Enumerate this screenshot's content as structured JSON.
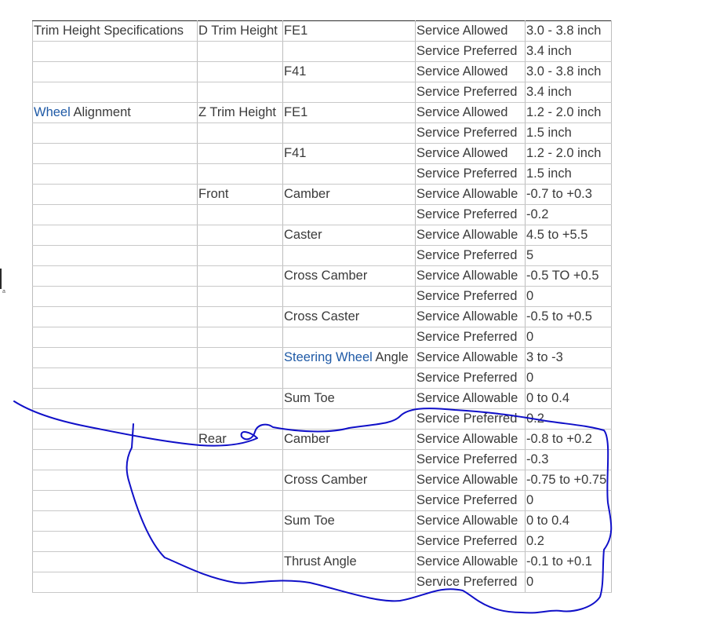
{
  "table": {
    "rows": [
      {
        "c1": "Trim Height Specifications",
        "c1_link": "",
        "c2": "D Trim Height",
        "c3": "FE1",
        "c3_link": "",
        "c4": "Service Allowed",
        "c5": "3.0 - 3.8 inch",
        "bold_top": true
      },
      {
        "c1": "",
        "c1_link": "",
        "c2": "",
        "c3": "",
        "c3_link": "",
        "c4": "Service Preferred",
        "c5": "3.4 inch",
        "bold_top": true
      },
      {
        "c1": "",
        "c1_link": "",
        "c2": "",
        "c3": "F41",
        "c3_link": "",
        "c4": "Service Allowed",
        "c5": "3.0 - 3.8 inch",
        "bold_top": false
      },
      {
        "c1": "",
        "c1_link": "",
        "c2": "",
        "c3": "",
        "c3_link": "",
        "c4": "Service Preferred",
        "c5": "3.4 inch",
        "bold_top": true
      },
      {
        "c1": " Alignment",
        "c1_link": "Wheel",
        "c2": "Z Trim Height",
        "c3": "FE1",
        "c3_link": "",
        "c4": "Service Allowed",
        "c5": "1.2 - 2.0 inch",
        "bold_top": true
      },
      {
        "c1": "",
        "c1_link": "",
        "c2": "",
        "c3": "",
        "c3_link": "",
        "c4": "Service Preferred",
        "c5": "1.5 inch",
        "bold_top": true
      },
      {
        "c1": "",
        "c1_link": "",
        "c2": "",
        "c3": "F41",
        "c3_link": "",
        "c4": "Service Allowed",
        "c5": "1.2 - 2.0 inch",
        "bold_top": false
      },
      {
        "c1": "",
        "c1_link": "",
        "c2": "",
        "c3": "",
        "c3_link": "",
        "c4": "Service Preferred",
        "c5": "1.5 inch",
        "bold_top": true
      },
      {
        "c1": "",
        "c1_link": "",
        "c2": "Front",
        "c3": "Camber",
        "c3_link": "",
        "c4": "Service Allowable",
        "c5": "-0.7 to +0.3",
        "bold_top": true
      },
      {
        "c1": "",
        "c1_link": "",
        "c2": "",
        "c3": "",
        "c3_link": "",
        "c4": "Service Preferred",
        "c5": "-0.2",
        "bold_top": true
      },
      {
        "c1": "",
        "c1_link": "",
        "c2": "",
        "c3": "Caster",
        "c3_link": "",
        "c4": "Service Allowable",
        "c5": "4.5 to +5.5",
        "bold_top": false
      },
      {
        "c1": "",
        "c1_link": "",
        "c2": "",
        "c3": "",
        "c3_link": "",
        "c4": "Service Preferred",
        "c5": "5",
        "bold_top": true
      },
      {
        "c1": "",
        "c1_link": "",
        "c2": "",
        "c3": "Cross Camber",
        "c3_link": "",
        "c4": "Service Allowable",
        "c5": "-0.5 TO +0.5",
        "bold_top": false
      },
      {
        "c1": "",
        "c1_link": "",
        "c2": "",
        "c3": "",
        "c3_link": "",
        "c4": "Service Preferred",
        "c5": "0",
        "bold_top": true
      },
      {
        "c1": "",
        "c1_link": "",
        "c2": "",
        "c3": "Cross Caster",
        "c3_link": "",
        "c4": "Service Allowable",
        "c5": "-0.5 to +0.5",
        "bold_top": false
      },
      {
        "c1": "",
        "c1_link": "",
        "c2": "",
        "c3": "",
        "c3_link": "",
        "c4": "Service Preferred",
        "c5": "0",
        "bold_top": true
      },
      {
        "c1": "",
        "c1_link": "",
        "c2": "",
        "c3": " Angle",
        "c3_link": "Steering Wheel",
        "c4": "Service Allowable",
        "c5": "3 to -3",
        "bold_top": false
      },
      {
        "c1": "",
        "c1_link": "",
        "c2": "",
        "c3": "",
        "c3_link": "",
        "c4": "Service Preferred",
        "c5": "0",
        "bold_top": true
      },
      {
        "c1": "",
        "c1_link": "",
        "c2": "",
        "c3": "Sum Toe",
        "c3_link": "",
        "c4": "Service Allowable",
        "c5": "0 to 0.4",
        "bold_top": false
      },
      {
        "c1": "",
        "c1_link": "",
        "c2": "",
        "c3": "",
        "c3_link": "",
        "c4": "Service Preferred",
        "c5": "0.2",
        "bold_top": true
      },
      {
        "c1": "",
        "c1_link": "",
        "c2": "Rear",
        "c3": "Camber",
        "c3_link": "",
        "c4": "Service Allowable",
        "c5": "-0.8 to +0.2",
        "bold_top": true
      },
      {
        "c1": "",
        "c1_link": "",
        "c2": "",
        "c3": "",
        "c3_link": "",
        "c4": "Service Preferred",
        "c5": "-0.3",
        "bold_top": true
      },
      {
        "c1": "",
        "c1_link": "",
        "c2": "",
        "c3": "Cross Camber",
        "c3_link": "",
        "c4": "Service Allowable",
        "c5": "-0.75 to +0.75",
        "bold_top": false
      },
      {
        "c1": "",
        "c1_link": "",
        "c2": "",
        "c3": "",
        "c3_link": "",
        "c4": "Service Preferred",
        "c5": "0",
        "bold_top": true
      },
      {
        "c1": "",
        "c1_link": "",
        "c2": "",
        "c3": "Sum Toe",
        "c3_link": "",
        "c4": "Service Allowable",
        "c5": "0 to 0.4",
        "bold_top": false
      },
      {
        "c1": "",
        "c1_link": "",
        "c2": "",
        "c3": "",
        "c3_link": "",
        "c4": "Service Preferred",
        "c5": "0.2",
        "bold_top": true
      },
      {
        "c1": "",
        "c1_link": "",
        "c2": "",
        "c3": "Thrust Angle",
        "c3_link": "",
        "c4": "Service Allowable",
        "c5": "-0.1 to +0.1",
        "bold_top": false
      },
      {
        "c1": "",
        "c1_link": "",
        "c2": "",
        "c3": "",
        "c3_link": "",
        "c4": "Service Preferred",
        "c5": "0",
        "bold_top": true
      }
    ]
  },
  "colors": {
    "link": "#1f5aa6",
    "annotation_ink": "#1010c8",
    "text": "#3a3a3a"
  },
  "edge_mark": "a"
}
